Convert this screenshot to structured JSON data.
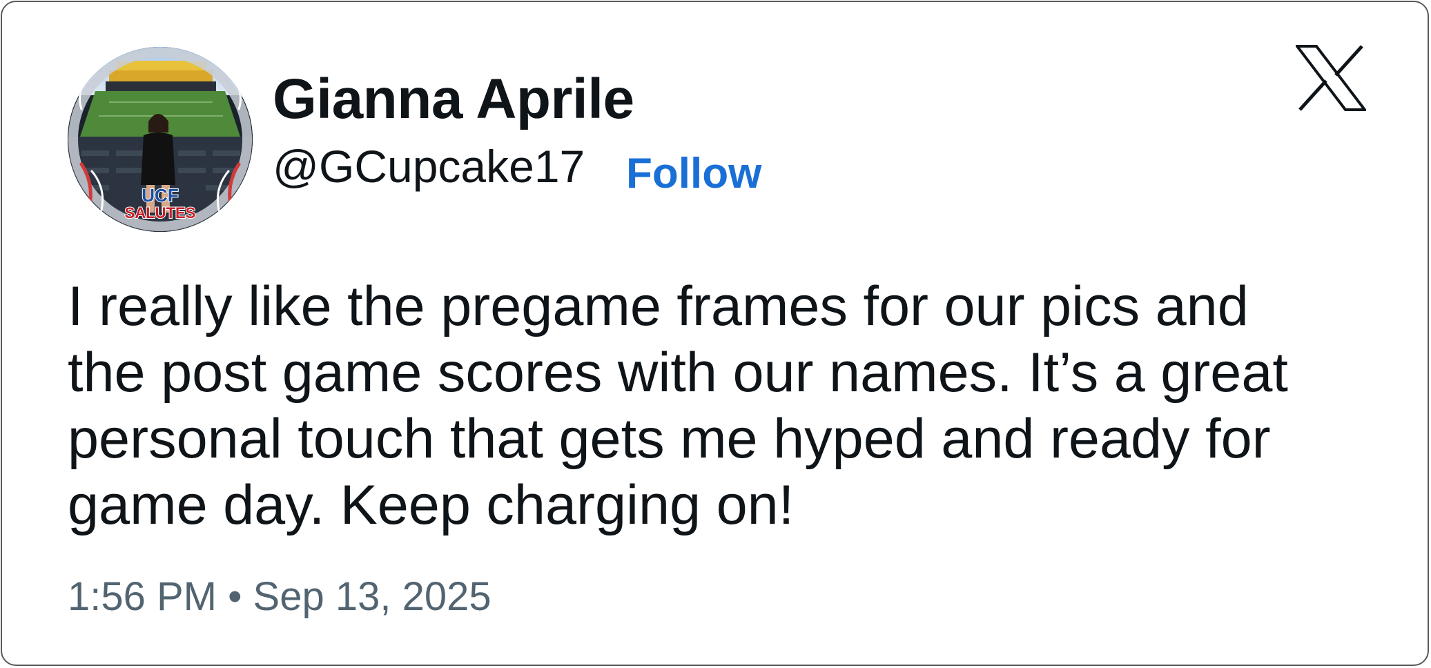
{
  "tweet": {
    "author": {
      "display_name": "Gianna Aprile",
      "handle": "@GCupcake17",
      "follow_label": "Follow",
      "avatar_badge_line1": "UCF",
      "avatar_badge_line2": "SALUTES"
    },
    "text_lines": [
      "I really like the pregame frames for our pics and",
      "the post game scores with our names. It’s a great",
      "personal touch that gets me hyped and ready for",
      "game day. Keep charging on!"
    ],
    "timestamp": "1:56 PM • Sep 13, 2025",
    "brand_icon": "x-logo-icon"
  },
  "colors": {
    "text_primary": "#0f1419",
    "text_secondary": "#536471",
    "follow_blue": "#1a6fd6",
    "border": "#5a5a5a"
  }
}
